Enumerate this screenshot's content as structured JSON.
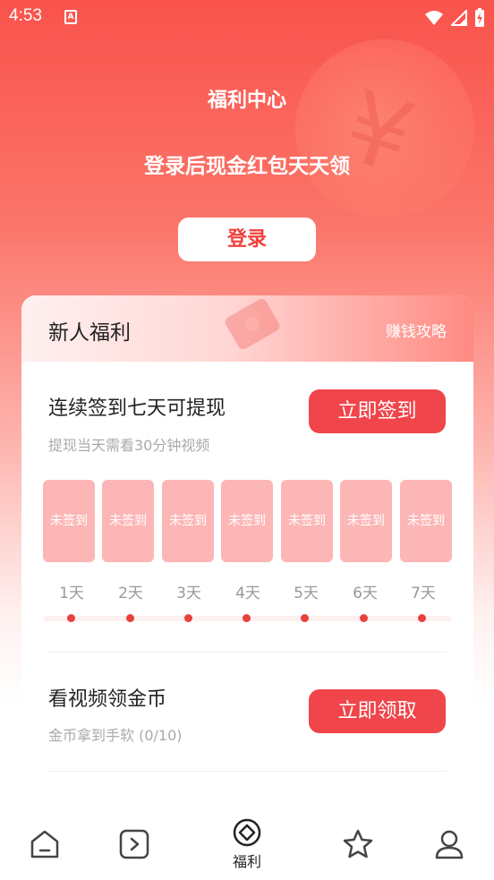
{
  "status_bar": {
    "time": "4:53",
    "notification_badge": "A"
  },
  "header": {
    "title": "福利中心",
    "subtitle": "登录后现金红包天天领",
    "login_label": "登录",
    "coin_symbol": "¥"
  },
  "card": {
    "title": "新人福利",
    "guide_link": "赚钱攻略",
    "checkin": {
      "title": "连续签到七天可提现",
      "subtitle": "提现当天需看30分钟视频",
      "button": "立即签到",
      "days": [
        {
          "status": "未签到",
          "label": "1天"
        },
        {
          "status": "未签到",
          "label": "2天"
        },
        {
          "status": "未签到",
          "label": "3天"
        },
        {
          "status": "未签到",
          "label": "4天"
        },
        {
          "status": "未签到",
          "label": "5天"
        },
        {
          "status": "未签到",
          "label": "6天"
        },
        {
          "status": "未签到",
          "label": "7天"
        }
      ]
    },
    "video": {
      "title": "看视频领金币",
      "subtitle": "金币拿到手软 (0/10)",
      "button": "立即领取"
    }
  },
  "tabbar": {
    "active_label": "福利"
  },
  "colors": {
    "accent": "#f0454a",
    "day_box": "#fdb6b6",
    "dot": "#e8413b"
  }
}
